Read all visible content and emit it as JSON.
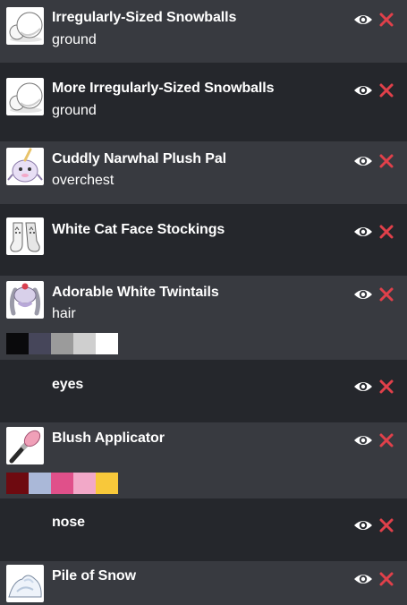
{
  "items": [
    {
      "title": "Irregularly-Sized Snowballs",
      "subtitle": "ground",
      "icon": "snowballs-icon"
    },
    {
      "title": "More Irregularly-Sized Snowballs",
      "subtitle": "ground",
      "icon": "snowballs-icon"
    },
    {
      "title": "Cuddly Narwhal Plush Pal",
      "subtitle": "overchest",
      "icon": "narwhal-plush-icon"
    },
    {
      "title": "White Cat Face Stockings",
      "subtitle": "",
      "icon": "cat-stockings-icon"
    },
    {
      "title": "Adorable White Twintails",
      "subtitle": "hair",
      "icon": "twintails-icon",
      "swatches": [
        "#0a0a0c",
        "#46465a",
        "#9b9b9b",
        "#cfcfcf",
        "#ffffff"
      ]
    },
    {
      "title": "eyes",
      "subtitle": "",
      "icon": ""
    },
    {
      "title": "Blush Applicator",
      "subtitle": "",
      "icon": "blush-brush-icon",
      "swatches": [
        "#6e0a10",
        "#aab8d8",
        "#e0508a",
        "#f2a8c8",
        "#f8c83a"
      ]
    },
    {
      "title": "nose",
      "subtitle": "",
      "icon": ""
    },
    {
      "title": "Pile of Snow",
      "subtitle": "",
      "icon": "snow-pile-icon"
    }
  ],
  "colors": {
    "row_alt": "#383a40",
    "row_plain": "#25272c",
    "eye": "#ffffff",
    "close": "#e0404a"
  }
}
